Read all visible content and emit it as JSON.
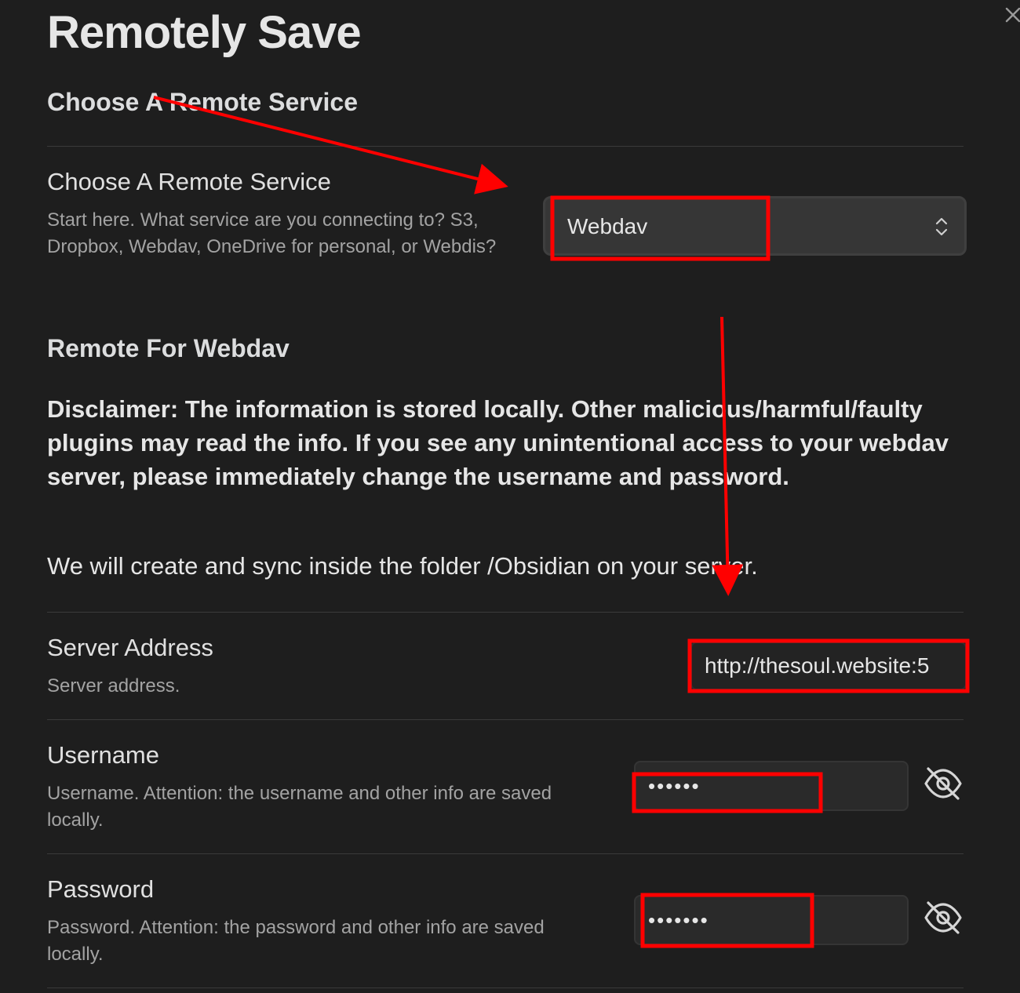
{
  "header": {
    "title": "Remotely Save",
    "close_icon": "close-icon"
  },
  "section_heading": "Choose A Remote Service",
  "remote_service": {
    "name": "Choose A Remote Service",
    "description": "Start here. What service are you connecting to? S3, Dropbox, Webdav, OneDrive for personal, or Webdis?",
    "selected": "Webdav",
    "chevron_icon": "chevron-up-down-icon"
  },
  "webdav": {
    "heading": "Remote For Webdav",
    "disclaimer": "Disclaimer: The information is stored locally. Other malicious/harmful/faulty plugins may read the info. If you see any unintentional access to your webdav server, please immediately change the username and password.",
    "folder_note": "We will create and sync inside the folder /Obsidian on your server."
  },
  "server_address": {
    "name": "Server Address",
    "description": "Server address.",
    "value": "http://thesoul.website:5"
  },
  "username": {
    "name": "Username",
    "description": "Username. Attention: the username and other info are saved locally.",
    "value": "123456",
    "toggle_icon": "eye-off-icon"
  },
  "password": {
    "name": "Password",
    "description": "Password. Attention: the password and other info are saved locally.",
    "value": "1234567",
    "toggle_icon": "eye-off-icon"
  },
  "annotations": {
    "color": "#ff0000"
  },
  "colors": {
    "background": "#1e1e1e",
    "text": "#dcddde",
    "muted_text": "#a3a3a3",
    "input_bg": "#2a2a2a",
    "annotation_red": "#ff0000"
  }
}
